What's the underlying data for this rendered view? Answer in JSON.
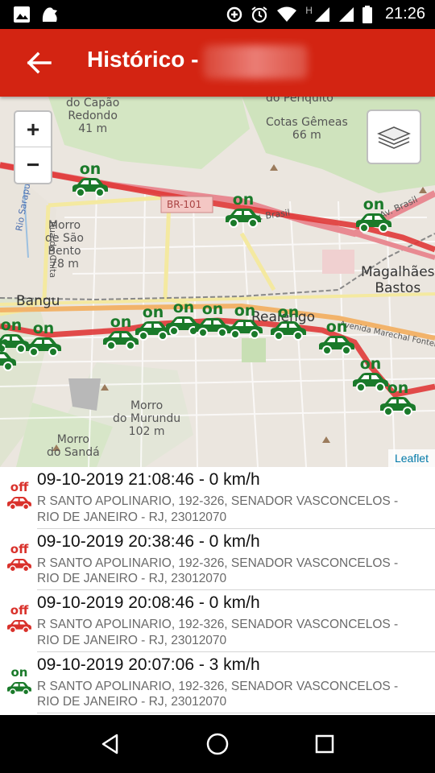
{
  "status_bar": {
    "time": "21:26",
    "left_icons": [
      "image-icon",
      "app-notification-icon"
    ],
    "right_icons": [
      "data-saver-icon",
      "alarm-icon",
      "wifi-icon",
      "signal-h-icon",
      "signal-icon",
      "battery-icon"
    ],
    "network_label": "H"
  },
  "app_bar": {
    "title": "Histórico -",
    "title_suffix_redacted": true,
    "color": "#d32412"
  },
  "map": {
    "zoom_in": "+",
    "zoom_out": "−",
    "attribution": "Leaflet",
    "labels": {
      "capao": "do Capão\nRedondo\n41 m",
      "perquito": "do Periquito",
      "cotas": "Cotas Gêmeas\n66 m",
      "br101": "BR-101",
      "sao_bento": "Morro\nde São\nBento\n78 m",
      "magalhaes": "Magalhães\nBastos",
      "bangu": "Bangu",
      "realengo": "Realengo",
      "murundu": "Morro\ndo Murundu\n102 m",
      "sandra": "Morro\ndo Sandá",
      "rua_da_chita": "Rua da Chita",
      "rio_sarapui": "Rio Sarapuí",
      "av_brasil_1": "Av. Brasil",
      "av_brasil_2": "Av. Brasil",
      "av_marechal": "Avenida Marechal Fontenelle"
    },
    "marker_label": "on",
    "marker_color": "#1a7a2a",
    "route_color": "#e03838"
  },
  "history": [
    {
      "status": "off",
      "heading": "09-10-2019 21:08:46 - 0 km/h",
      "address": "R SANTO APOLINARIO, 192-326, SENADOR VASCONCELOS - RIO DE JANEIRO - RJ, 23012070"
    },
    {
      "status": "off",
      "heading": "09-10-2019 20:38:46 - 0 km/h",
      "address": "R SANTO APOLINARIO, 192-326, SENADOR VASCONCELOS - RIO DE JANEIRO - RJ, 23012070"
    },
    {
      "status": "off",
      "heading": "09-10-2019 20:08:46 - 0 km/h",
      "address": "R SANTO APOLINARIO, 192-326, SENADOR VASCONCELOS - RIO DE JANEIRO - RJ, 23012070"
    },
    {
      "status": "on",
      "heading": "09-10-2019 20:07:06 - 3 km/h",
      "address": "R SANTO APOLINARIO, 192-326, SENADOR VASCONCELOS - RIO DE JANEIRO - RJ, 23012070"
    }
  ],
  "status_colors": {
    "on": "#1a7a2a",
    "off": "#d9312b"
  },
  "nav_bar": [
    "back-triangle-icon",
    "home-circle-icon",
    "recents-square-icon"
  ]
}
